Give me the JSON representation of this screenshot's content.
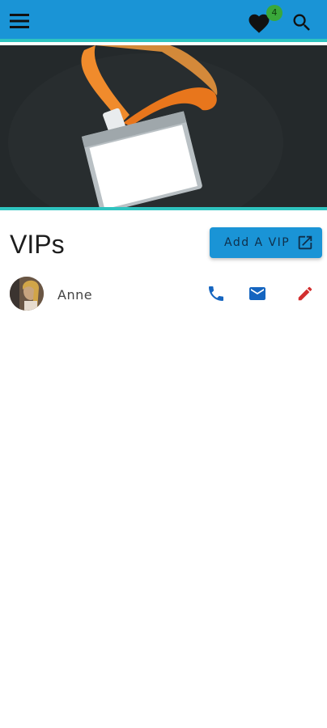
{
  "appbar": {
    "menu_icon": "hamburger-menu-icon",
    "favorites_icon": "heart-icon",
    "favorites_count": "4",
    "search_icon": "search-icon",
    "colors": {
      "bar": "#1a94d6",
      "accent": "#2fc4c0",
      "badge": "#3aa83a"
    }
  },
  "hero": {
    "image": "lanyard-id-badge-photo"
  },
  "page": {
    "title": "VIPs"
  },
  "add_vip_button": {
    "label": "Add A VIP",
    "icon": "open-in-new-icon"
  },
  "vips": [
    {
      "name": "Anne",
      "avatar": "avatar-photo",
      "call_icon": "phone-icon",
      "email_icon": "mail-icon",
      "edit_icon": "pencil-icon"
    }
  ]
}
